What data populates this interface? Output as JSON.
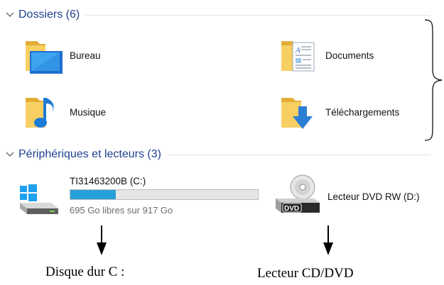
{
  "folders_section": {
    "title": "Dossiers (6)",
    "items": [
      {
        "label": "Bureau",
        "icon": "desktop-folder-icon"
      },
      {
        "label": "Documents",
        "icon": "documents-folder-icon"
      },
      {
        "label": "Musique",
        "icon": "music-folder-icon"
      },
      {
        "label": "Téléchargements",
        "icon": "downloads-folder-icon"
      }
    ]
  },
  "devices_section": {
    "title": "Périphériques et lecteurs (3)",
    "drives": [
      {
        "name": "TI31463200B (C:)",
        "free_text": "695 Go libres sur 917 Go",
        "used_fraction": 0.242,
        "icon": "windows-hard-drive-icon"
      },
      {
        "name": "Lecteur DVD RW (D:)",
        "icon": "dvd-drive-icon"
      }
    ]
  },
  "annotations": {
    "disk_caption": "Disque dur C :",
    "dvd_caption": "Lecteur CD/DVD"
  },
  "colors": {
    "header_text": "#1e3f8f",
    "progress_fill": "#26a0da",
    "folder_yellow": "#f7cf63",
    "folder_dark": "#e3ad35",
    "arrow_blue": "#2d7fd6"
  }
}
